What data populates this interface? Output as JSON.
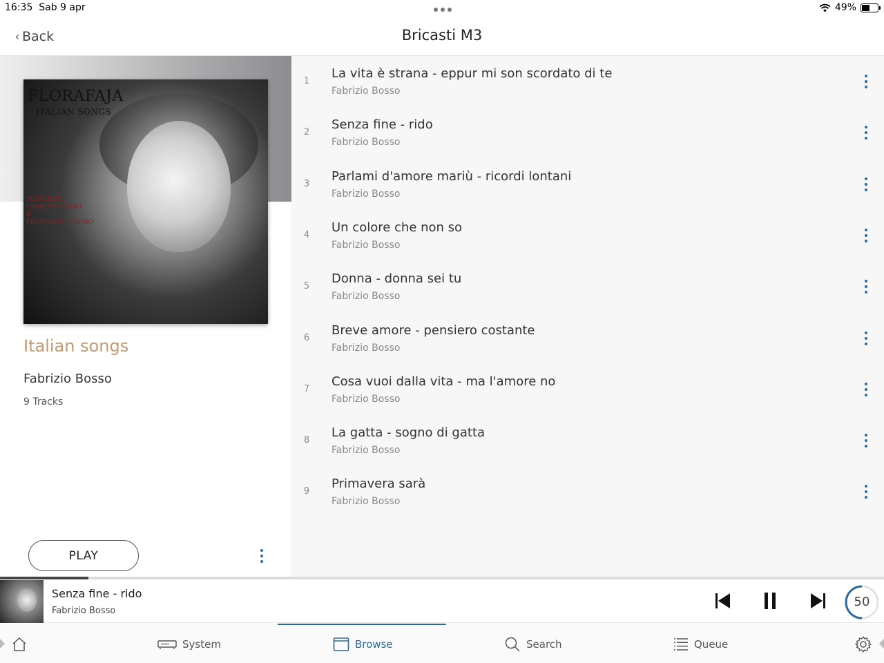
{
  "status_bar": {
    "time": "16:35",
    "date": "Sab 9 apr",
    "battery": "49%",
    "battery_level": 0.49
  },
  "header": {
    "back_label": "Back",
    "title": "Bricasti M3"
  },
  "album": {
    "cover_brand": "FLORAFAJA",
    "cover_subtitle": "ITALIAN SONGS",
    "cover_featuring": "FEATURING\nFABRIZIO BOSSO\n&\nFRANCESCO CAFISO",
    "title": "Italian songs",
    "artist": "Fabrizio Bosso",
    "track_count": "9 Tracks",
    "play_label": "PLAY"
  },
  "tracks": [
    {
      "num": "1",
      "title": "La vita è strana - eppur mi son scordato di te",
      "artist": "Fabrizio Bosso"
    },
    {
      "num": "2",
      "title": "Senza fine - rido",
      "artist": "Fabrizio Bosso"
    },
    {
      "num": "3",
      "title": "Parlami d'amore mariù - ricordi lontani",
      "artist": "Fabrizio Bosso"
    },
    {
      "num": "4",
      "title": "Un colore che non so",
      "artist": "Fabrizio Bosso"
    },
    {
      "num": "5",
      "title": "Donna - donna sei tu",
      "artist": "Fabrizio Bosso"
    },
    {
      "num": "6",
      "title": "Breve amore - pensiero costante",
      "artist": "Fabrizio Bosso"
    },
    {
      "num": "7",
      "title": "Cosa vuoi dalla vita - ma l'amore no",
      "artist": "Fabrizio Bosso"
    },
    {
      "num": "8",
      "title": "La gatta - sogno di gatta",
      "artist": "Fabrizio Bosso"
    },
    {
      "num": "9",
      "title": "Primavera sarà",
      "artist": "Fabrizio Bosso"
    }
  ],
  "now_playing": {
    "title": "Senza fine - rido",
    "artist": "Fabrizio Bosso",
    "progress": 0.1,
    "volume": "50",
    "volume_level": 0.5
  },
  "nav": {
    "system": "System",
    "browse": "Browse",
    "search": "Search",
    "queue": "Queue",
    "active": "browse"
  },
  "colors": {
    "accent": "#2b6a9b",
    "album_title": "#c39a6e",
    "list_background": "#f7f7f7"
  }
}
